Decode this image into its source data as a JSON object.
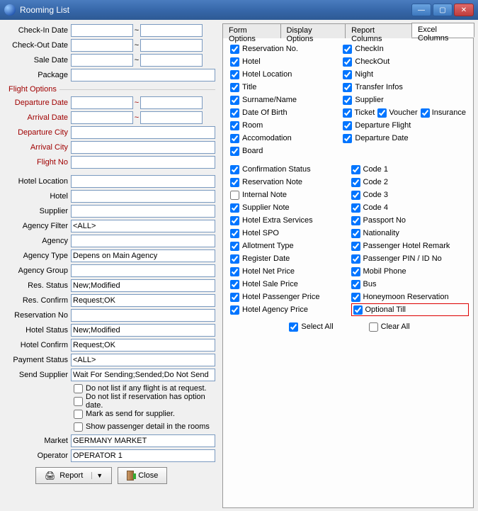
{
  "window": {
    "title": "Rooming List"
  },
  "left": {
    "check_in": "Check-In Date",
    "check_out": "Check-Out Date",
    "sale_date": "Sale Date",
    "package": "Package",
    "flight_options": "Flight Options",
    "departure_date": "Departure Date",
    "arrival_date": "Arrival Date",
    "departure_city": "Departure City",
    "arrival_city": "Arrival City",
    "flight_no": "Flight No",
    "hotel_location": "Hotel Location",
    "hotel": "Hotel",
    "supplier": "Supplier",
    "agency_filter": "Agency Filter",
    "agency_filter_val": "<ALL>",
    "agency": "Agency",
    "agency_type": "Agency Type",
    "agency_type_val": "Depens on Main Agency",
    "agency_group": "Agency Group",
    "res_status": "Res. Status",
    "res_status_val": "New;Modified",
    "res_confirm": "Res. Confirm",
    "res_confirm_val": "Request;OK",
    "reservation_no": "Reservation No",
    "hotel_status": "Hotel Status",
    "hotel_status_val": "New;Modified",
    "hotel_confirm": "Hotel Confirm",
    "hotel_confirm_val": "Request;OK",
    "payment_status": "Payment Status",
    "payment_status_val": "<ALL>",
    "send_supplier": "Send Supplier",
    "send_supplier_val": "Wait For Sending;Sended;Do Not Send",
    "chk1": "Do not list if any flight is at request.",
    "chk2": "Do not list if reservation has option date.",
    "chk3": "Mark as send for supplier.",
    "chk4": "Show passenger detail in the rooms",
    "market": "Market",
    "market_val": "GERMANY MARKET",
    "operator": "Operator",
    "operator_val": "OPERATOR 1",
    "report_btn": "Report",
    "close_btn": "Close"
  },
  "tabs": {
    "t1": "Form Options",
    "t2": "Display Options",
    "t3": "Report Columns",
    "t4": "Excel Columns"
  },
  "excel_cols": {
    "left": [
      {
        "label": "Reservation No.",
        "checked": true
      },
      {
        "label": "Hotel",
        "checked": true
      },
      {
        "label": "Hotel Location",
        "checked": true
      },
      {
        "label": "Title",
        "checked": true
      },
      {
        "label": "Surname/Name",
        "checked": true
      },
      {
        "label": "Date Of Birth",
        "checked": true
      },
      {
        "label": "Room",
        "checked": true
      },
      {
        "label": "Accomodation",
        "checked": true
      },
      {
        "label": "Board",
        "checked": true
      }
    ],
    "right": [
      {
        "label": "CheckIn",
        "checked": true
      },
      {
        "label": "CheckOut",
        "checked": true
      },
      {
        "label": "Night",
        "checked": true
      },
      {
        "label": "Transfer Infos",
        "checked": true
      },
      {
        "label": "Supplier",
        "checked": true
      }
    ],
    "ticket_row": [
      {
        "label": "Ticket",
        "checked": true
      },
      {
        "label": "Voucher",
        "checked": true
      },
      {
        "label": "Insurance",
        "checked": true
      }
    ],
    "right2": [
      {
        "label": "Departure Flight",
        "checked": true
      },
      {
        "label": "Departure Date",
        "checked": true
      }
    ],
    "left2": [
      {
        "label": "Confirmation Status",
        "checked": true
      },
      {
        "label": "Reservation Note",
        "checked": true
      },
      {
        "label": "Internal Note",
        "checked": false
      },
      {
        "label": "Supplier Note",
        "checked": true
      },
      {
        "label": "Hotel Extra Services",
        "checked": true
      },
      {
        "label": "Hotel SPO",
        "checked": true
      },
      {
        "label": "Allotment Type",
        "checked": true
      },
      {
        "label": "Register Date",
        "checked": true
      },
      {
        "label": "Hotel Net Price",
        "checked": true
      },
      {
        "label": "Hotel Sale Price",
        "checked": true
      },
      {
        "label": "Hotel Passenger Price",
        "checked": true
      },
      {
        "label": "Hotel Agency Price",
        "checked": true
      }
    ],
    "right3": [
      {
        "label": "Code 1",
        "checked": true
      },
      {
        "label": "Code 2",
        "checked": true
      },
      {
        "label": "Code 3",
        "checked": true
      },
      {
        "label": "Code 4",
        "checked": true
      },
      {
        "label": "Passport No",
        "checked": true
      },
      {
        "label": "Nationality",
        "checked": true
      },
      {
        "label": "Passenger Hotel Remark",
        "checked": true
      },
      {
        "label": "Passenger PIN / ID No",
        "checked": true
      },
      {
        "label": "Mobil Phone",
        "checked": true
      },
      {
        "label": "Bus",
        "checked": true
      },
      {
        "label": "Honeymoon Reservation",
        "checked": true
      },
      {
        "label": "Optional Till",
        "checked": true,
        "highlight": true
      }
    ],
    "select_all": "Select All",
    "clear_all": "Clear All"
  }
}
